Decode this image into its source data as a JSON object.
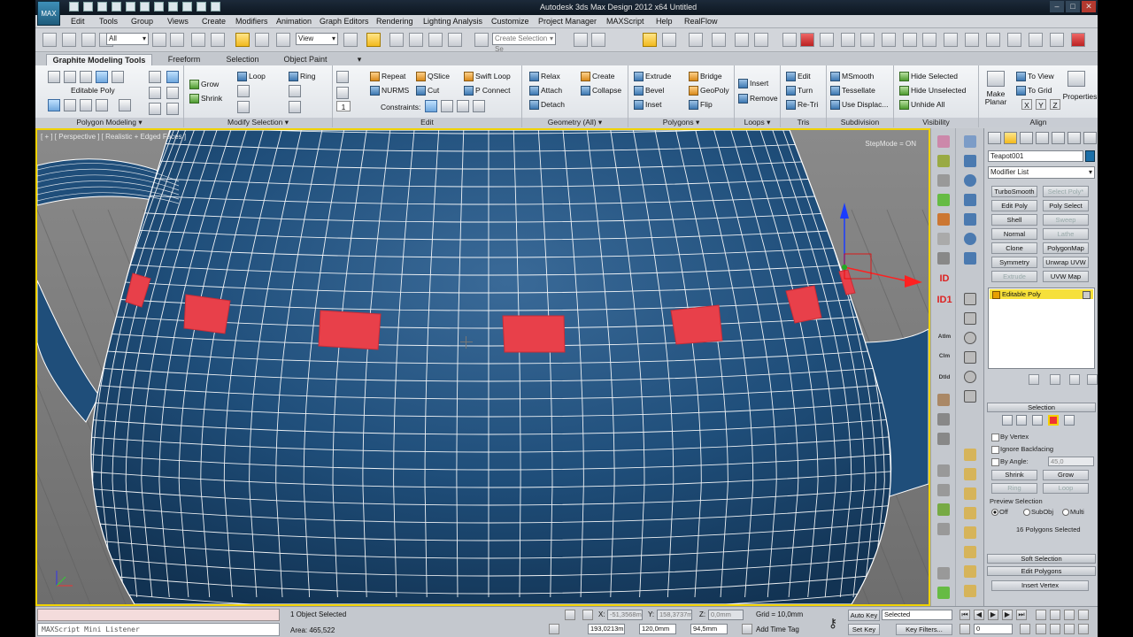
{
  "window": {
    "title": "Autodesk 3ds Max Design 2012 x64      Untitled",
    "logo": "MAX"
  },
  "menu": [
    "Edit",
    "Tools",
    "Group",
    "Views",
    "Create",
    "Modifiers",
    "Animation",
    "Graph Editors",
    "Rendering",
    "Lighting Analysis",
    "Customize",
    "Project Manager",
    "MAXScript",
    "Help",
    "RealFlow"
  ],
  "toolbar": {
    "filter_value": "All",
    "coord_value": "View",
    "selection_set_placeholder": "Create Selection Se"
  },
  "ribbon": {
    "tabs": [
      "Graphite Modeling Tools",
      "Freeform",
      "Selection",
      "Object Paint"
    ],
    "object_label": "Editable Poly",
    "panels": {
      "polygon_modeling": "Polygon Modeling ▾",
      "modify_selection": "Modify Selection ▾",
      "edit": "Edit",
      "geometry": "Geometry (All) ▾",
      "polygons": "Polygons ▾",
      "loops": "Loops ▾",
      "tris": "Tris",
      "subdivision": "Subdivision",
      "visibility": "Visibility",
      "align": "Align"
    },
    "modify": {
      "grow": "Grow",
      "shrink": "Shrink",
      "loop": "Loop",
      "ring": "Ring"
    },
    "edit": {
      "repeat": "Repeat",
      "nurms": "NURMS",
      "qslice": "QSlice",
      "cut": "Cut",
      "swift_loop": "Swift Loop",
      "p_connect": "P Connect",
      "constraints": "Constraints:",
      "spinner": "1"
    },
    "geometry": {
      "relax": "Relax",
      "create": "Create",
      "attach": "Attach",
      "collapse": "Collapse",
      "detach": "Detach"
    },
    "polygons": {
      "extrude": "Extrude",
      "bridge": "Bridge",
      "bevel": "Bevel",
      "geopoly": "GeoPoly",
      "inset": "Inset",
      "flip": "Flip"
    },
    "loops": {
      "insert": "Insert",
      "remove": "Remove"
    },
    "tris": {
      "edit": "Edit",
      "turn": "Turn",
      "retri": "Re-Tri"
    },
    "subdivision": {
      "msmooth": "MSmooth",
      "tessellate": "Tessellate",
      "use_displac": "Use Displac..."
    },
    "visibility": {
      "hide_selected": "Hide Selected",
      "hide_unselected": "Hide Unselected",
      "unhide_all": "Unhide All"
    },
    "align": {
      "make_planar": "Make Planar",
      "to_view": "To View",
      "to_grid": "To Grid",
      "x": "X",
      "y": "Y",
      "z": "Z",
      "properties": "Properties"
    }
  },
  "viewport": {
    "label": "[ + ] [ Perspective ] [ Realistic + Edged Faces ]",
    "stepmode": "StepMode = ON",
    "colors": {
      "mesh": "#1f4e7a",
      "wire": "#ffffff",
      "selected": "#e8404a",
      "background": "#7a7a7a",
      "border": "#f0d200"
    }
  },
  "command_panel": {
    "object_name": "Teapot001",
    "modifier_list": "Modifier List",
    "modifier_buttons": [
      [
        "TurboSmooth",
        "Select Poly*"
      ],
      [
        "Edit Poly",
        "Poly Select"
      ],
      [
        "Shell",
        "Sweep"
      ],
      [
        "Normal",
        "Lathe"
      ],
      [
        "Clone",
        "PolygonMap"
      ],
      [
        "Symmetry",
        "Unwrap UVW"
      ],
      [
        "Extrude",
        "UVW Map"
      ]
    ],
    "stack_item": "Editable Poly",
    "selection": {
      "title": "Selection",
      "by_vertex": "By Vertex",
      "ignore_backfacing": "Ignore Backfacing",
      "by_angle": "By Angle:",
      "angle_value": "45,0",
      "shrink": "Shrink",
      "grow": "Grow",
      "ring": "Ring",
      "loop": "Loop",
      "preview_selection": "Preview Selection",
      "off": "Off",
      "subobj": "SubObj",
      "multi": "Multi",
      "status": "16 Polygons Selected"
    },
    "soft_selection": "Soft Selection",
    "edit_polygons": "Edit Polygons",
    "insert_vertex": "Insert Vertex",
    "side_labels": {
      "id1": "ID",
      "id2": "ID1",
      "atlm": "Atlm",
      "clm": "Clm",
      "dsd": "Dtld"
    }
  },
  "status": {
    "maxscript_label": "MAXScript Mini Listener",
    "object_selected": "1 Object Selected",
    "area": "Area: 465,522",
    "x_label": "X:",
    "x_value": "-51,3568m",
    "y_label": "Y:",
    "y_value": "158,3737m",
    "z_label": "Z:",
    "z_value": "0,0mm",
    "grid": "Grid = 10,0mm",
    "time_field_1": "193,0213m",
    "time_field_2": "120,0mm",
    "time_field_3": "94,5mm",
    "add_time_tag": "Add Time Tag",
    "auto_key": "Auto Key",
    "set_key": "Set Key",
    "selected": "Selected",
    "key_filters": "Key Filters...",
    "frame": "0"
  }
}
